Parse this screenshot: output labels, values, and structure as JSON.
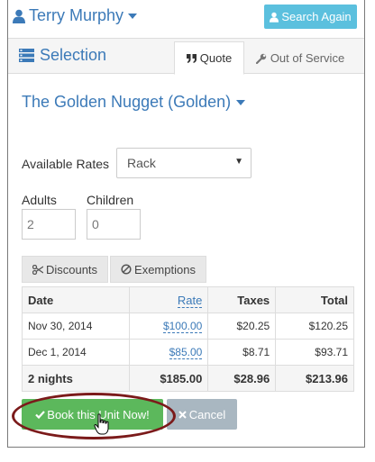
{
  "header": {
    "user_name": "Terry Murphy",
    "search_again_label": "Search Again"
  },
  "selection": {
    "title": "Selection",
    "tabs": [
      {
        "label": "Quote",
        "active": true
      },
      {
        "label": "Out of Service",
        "active": false
      }
    ]
  },
  "hotel": {
    "name": "The Golden Nugget (Golden)"
  },
  "form": {
    "available_rates_label": "Available Rates",
    "available_rates_value": "Rack",
    "adults_label": "Adults",
    "adults_value": "2",
    "children_label": "Children",
    "children_value": "0"
  },
  "subtabs": {
    "discounts_label": "Discounts",
    "exemptions_label": "Exemptions"
  },
  "rates_table": {
    "headers": [
      "Date",
      "Rate",
      "Taxes",
      "Total"
    ],
    "rows": [
      {
        "date": "Nov 30, 2014",
        "rate": "$100.00",
        "taxes": "$20.25",
        "total": "$120.25"
      },
      {
        "date": "Dec 1, 2014",
        "rate": "$85.00",
        "taxes": "$8.71",
        "total": "$93.71"
      }
    ],
    "total_row": {
      "date": "2 nights",
      "rate": "$185.00",
      "taxes": "$28.96",
      "total": "$213.96"
    }
  },
  "actions": {
    "book_label": "Book this Unit Now!",
    "cancel_label": "Cancel"
  },
  "colors": {
    "primary_link": "#3c7ab8",
    "info_button": "#5bc0de",
    "success_button": "#5cb85c",
    "cancel_button": "#a9b7c1",
    "highlight_ring": "#7b1a1a"
  },
  "icons": [
    "user-icon",
    "search-icon",
    "list-icon",
    "quote-icon",
    "wrench-icon",
    "scissors-icon",
    "ban-icon",
    "check-icon",
    "times-icon",
    "hand-cursor-icon"
  ]
}
